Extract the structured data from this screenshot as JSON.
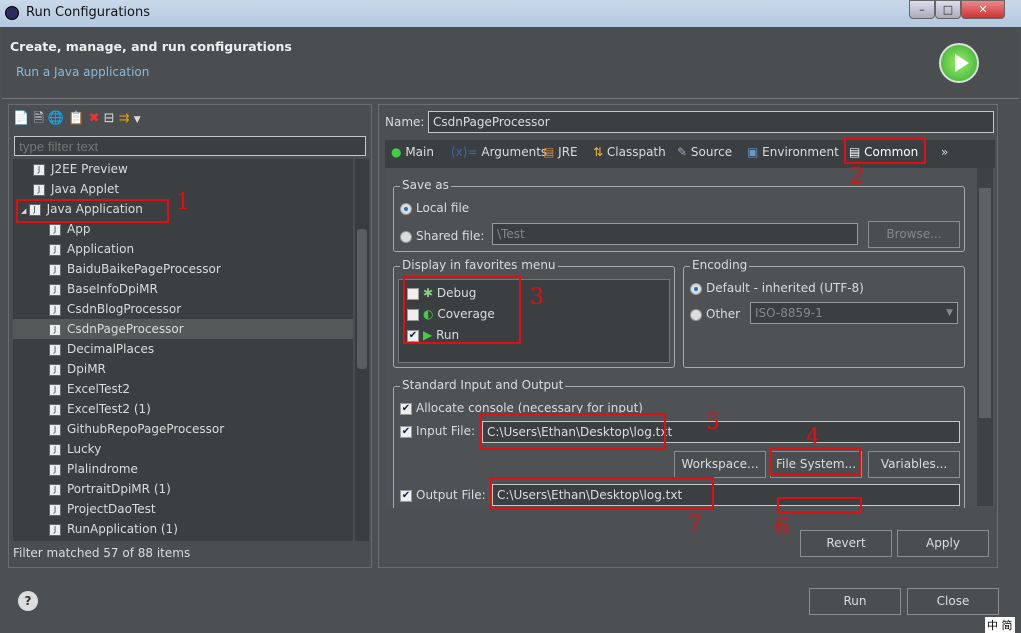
{
  "window": {
    "title": "Run Configurations"
  },
  "header": {
    "title": "Create, manage, and run configurations",
    "subtitle": "Run a Java application"
  },
  "left": {
    "filter_placeholder": "type filter text",
    "items": [
      {
        "label": "J2EE Preview",
        "level": 1
      },
      {
        "label": "Java Applet",
        "level": 1
      },
      {
        "label": "Java Application",
        "level": 1,
        "expanded": true
      },
      {
        "label": "App",
        "level": 2
      },
      {
        "label": "Application",
        "level": 2
      },
      {
        "label": "BaiduBaikePageProcessor",
        "level": 2
      },
      {
        "label": "BaseInfoDpiMR",
        "level": 2
      },
      {
        "label": "CsdnBlogProcessor",
        "level": 2
      },
      {
        "label": "CsdnPageProcessor",
        "level": 2,
        "selected": true
      },
      {
        "label": "DecimalPlaces",
        "level": 2
      },
      {
        "label": "DpiMR",
        "level": 2
      },
      {
        "label": "ExcelTest2",
        "level": 2
      },
      {
        "label": "ExcelTest2 (1)",
        "level": 2
      },
      {
        "label": "GithubRepoPageProcessor",
        "level": 2
      },
      {
        "label": "Lucky",
        "level": 2
      },
      {
        "label": "Plalindrome",
        "level": 2
      },
      {
        "label": "PortraitDpiMR (1)",
        "level": 2
      },
      {
        "label": "ProjectDaoTest",
        "level": 2
      },
      {
        "label": "RunApplication (1)",
        "level": 2
      }
    ],
    "status": "Filter matched 57 of 88 items"
  },
  "right": {
    "name_label": "Name:",
    "name_value": "CsdnPageProcessor",
    "tabs": [
      "Main",
      "Arguments",
      "JRE",
      "Classpath",
      "Source",
      "Environment",
      "Common"
    ],
    "active_tab": "Common",
    "more_tabs": "»",
    "save_as": {
      "title": "Save as",
      "local": "Local file",
      "shared": "Shared file:",
      "shared_value": "\\Test",
      "browse": "Browse..."
    },
    "favorites": {
      "title": "Display in favorites menu",
      "items": [
        {
          "label": "Debug",
          "checked": false
        },
        {
          "label": "Coverage",
          "checked": false
        },
        {
          "label": "Run",
          "checked": true
        }
      ]
    },
    "encoding": {
      "title": "Encoding",
      "default": "Default - inherited (UTF-8)",
      "other": "Other",
      "other_value": "ISO-8859-1"
    },
    "stdio": {
      "title": "Standard Input and Output",
      "allocate": "Allocate console (necessary for input)",
      "input_label": "Input File:",
      "input_value": "C:\\Users\\Ethan\\Desktop\\log.txt",
      "workspace": "Workspace...",
      "filesystem": "File System...",
      "variables": "Variables...",
      "output_label": "Output File:",
      "output_value": "C:\\Users\\Ethan\\Desktop\\log.txt"
    },
    "revert": "Revert",
    "apply": "Apply"
  },
  "footer": {
    "run": "Run",
    "close": "Close",
    "ime": "中 简"
  },
  "annotations": [
    "1",
    "2",
    "3",
    "4",
    "5",
    "6",
    "7"
  ]
}
